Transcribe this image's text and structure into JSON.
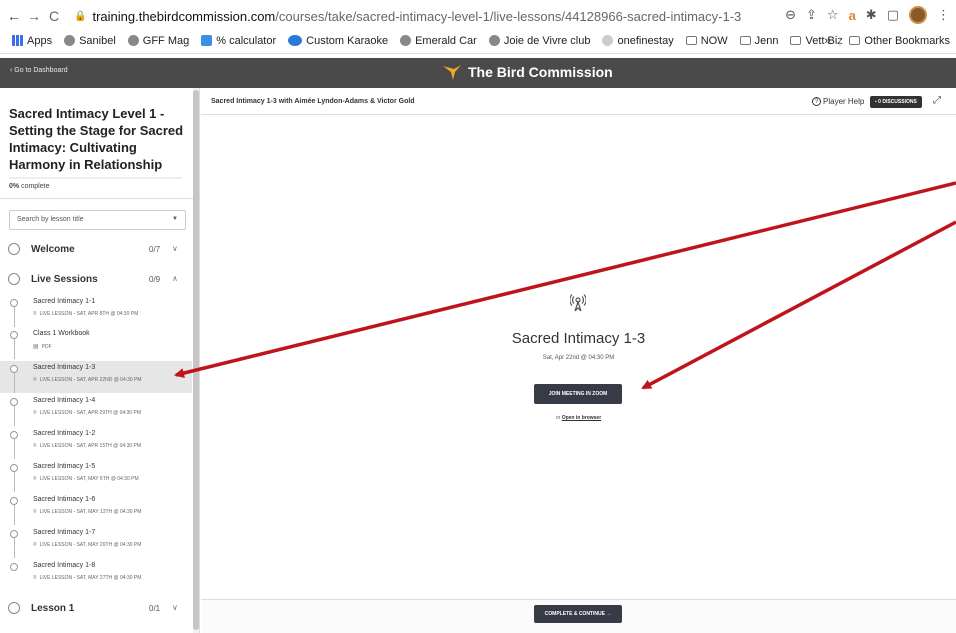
{
  "browser": {
    "url_host": "training.thebirdcommission.com",
    "url_path": "/courses/take/sacred-intimacy-level-1/live-lessons/44128966-sacred-intimacy-1-3",
    "nav": {
      "back": "←",
      "forward": "→",
      "reload": "C"
    }
  },
  "bookmarks": {
    "items": [
      "Apps",
      "Sanibel",
      "GFF Mag",
      "% calculator",
      "Custom Karaoke",
      "Emerald Car",
      "Joie de Vivre club",
      "onefinestay",
      "NOW",
      "Jenn",
      "Vett Biz"
    ],
    "overflow": "»",
    "other": "Other Bookmarks"
  },
  "site": {
    "back_link": "‹  Go to Dashboard",
    "brand": "The Bird Commission"
  },
  "sidebar": {
    "course_title": "Sacred Intimacy Level 1 - Setting the Stage for Sacred Intimacy: Cultivating Harmony in Relationship",
    "progress_value": "0%",
    "progress_label": " complete",
    "search_placeholder": "Search by lesson title",
    "sections": [
      {
        "label": "Welcome",
        "count": "0/7",
        "chevron": "∨"
      },
      {
        "label": "Live Sessions",
        "count": "0/9",
        "chevron": "∧"
      },
      {
        "label": "Lesson 1",
        "count": "0/1",
        "chevron": "∨"
      }
    ],
    "lessons": [
      {
        "title": "Sacred Intimacy 1-1",
        "sub": "LIVE LESSON - SAT, APR 8TH @ 04:30 PM"
      },
      {
        "title": "Class 1 Workbook",
        "sub": "PDF"
      },
      {
        "title": "Sacred Intimacy 1-3",
        "sub": "LIVE LESSON - SAT, APR 22ND @ 04:30 PM"
      },
      {
        "title": "Sacred Intimacy 1-4",
        "sub": "LIVE LESSON - SAT, APR 29TH @ 04:30 PM"
      },
      {
        "title": "Sacred Intimacy 1-2",
        "sub": "LIVE LESSON - SAT, APR 15TH @ 04:30 PM"
      },
      {
        "title": "Sacred Intimacy 1-5",
        "sub": "LIVE LESSON - SAT, MAY 6TH @ 04:30 PM"
      },
      {
        "title": "Sacred Intimacy 1-6",
        "sub": "LIVE LESSON - SAT, MAY 13TH @ 04:30 PM"
      },
      {
        "title": "Sacred Intimacy 1-7",
        "sub": "LIVE LESSON - SAT, MAY 20TH @ 04:30 PM"
      },
      {
        "title": "Sacred Intimacy 1-8",
        "sub": "LIVE LESSON - SAT, MAY 27TH @ 04:30 PM"
      }
    ]
  },
  "main": {
    "lesson_header": "Sacred Intimacy 1-3 with Aimée Lyndon-Adams & Victor Gold",
    "player_help": "Player Help",
    "discussions": "0 DISCUSSIONS",
    "live_title": "Sacred Intimacy 1-3",
    "live_date": "Sat, Apr 22nd @ 04:30 PM",
    "join_button": "JOIN MEETING IN ZOOM",
    "or_text": "or ",
    "open_browser": "Open in browser",
    "complete_button": "COMPLETE & CONTINUE  →"
  },
  "colors": {
    "header_bg": "#4a4a4a",
    "button_bg": "#363b45",
    "active_lesson_bg": "#e6e6e6",
    "annotation_arrow": "#c0141c",
    "brand_bird": "#f5a623"
  }
}
